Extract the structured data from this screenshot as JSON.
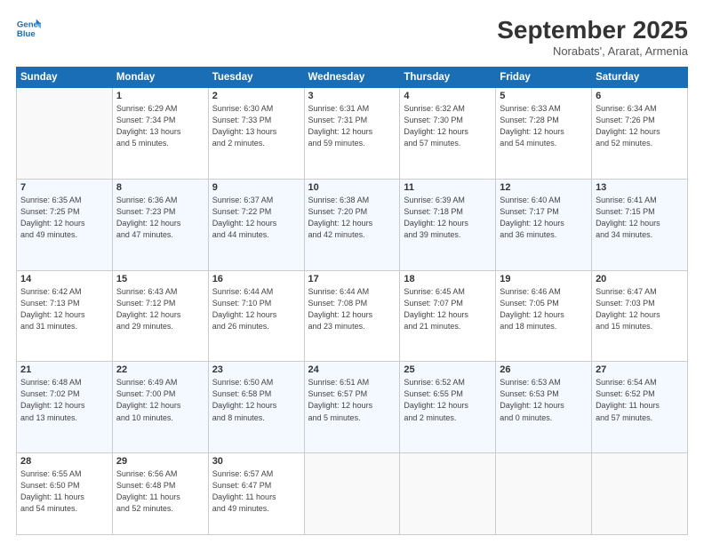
{
  "header": {
    "logo_line1": "General",
    "logo_line2": "Blue",
    "month": "September 2025",
    "location": "Norabats', Ararat, Armenia"
  },
  "days_of_week": [
    "Sunday",
    "Monday",
    "Tuesday",
    "Wednesday",
    "Thursday",
    "Friday",
    "Saturday"
  ],
  "weeks": [
    [
      {
        "day": "",
        "info": ""
      },
      {
        "day": "1",
        "info": "Sunrise: 6:29 AM\nSunset: 7:34 PM\nDaylight: 13 hours\nand 5 minutes."
      },
      {
        "day": "2",
        "info": "Sunrise: 6:30 AM\nSunset: 7:33 PM\nDaylight: 13 hours\nand 2 minutes."
      },
      {
        "day": "3",
        "info": "Sunrise: 6:31 AM\nSunset: 7:31 PM\nDaylight: 12 hours\nand 59 minutes."
      },
      {
        "day": "4",
        "info": "Sunrise: 6:32 AM\nSunset: 7:30 PM\nDaylight: 12 hours\nand 57 minutes."
      },
      {
        "day": "5",
        "info": "Sunrise: 6:33 AM\nSunset: 7:28 PM\nDaylight: 12 hours\nand 54 minutes."
      },
      {
        "day": "6",
        "info": "Sunrise: 6:34 AM\nSunset: 7:26 PM\nDaylight: 12 hours\nand 52 minutes."
      }
    ],
    [
      {
        "day": "7",
        "info": "Sunrise: 6:35 AM\nSunset: 7:25 PM\nDaylight: 12 hours\nand 49 minutes."
      },
      {
        "day": "8",
        "info": "Sunrise: 6:36 AM\nSunset: 7:23 PM\nDaylight: 12 hours\nand 47 minutes."
      },
      {
        "day": "9",
        "info": "Sunrise: 6:37 AM\nSunset: 7:22 PM\nDaylight: 12 hours\nand 44 minutes."
      },
      {
        "day": "10",
        "info": "Sunrise: 6:38 AM\nSunset: 7:20 PM\nDaylight: 12 hours\nand 42 minutes."
      },
      {
        "day": "11",
        "info": "Sunrise: 6:39 AM\nSunset: 7:18 PM\nDaylight: 12 hours\nand 39 minutes."
      },
      {
        "day": "12",
        "info": "Sunrise: 6:40 AM\nSunset: 7:17 PM\nDaylight: 12 hours\nand 36 minutes."
      },
      {
        "day": "13",
        "info": "Sunrise: 6:41 AM\nSunset: 7:15 PM\nDaylight: 12 hours\nand 34 minutes."
      }
    ],
    [
      {
        "day": "14",
        "info": "Sunrise: 6:42 AM\nSunset: 7:13 PM\nDaylight: 12 hours\nand 31 minutes."
      },
      {
        "day": "15",
        "info": "Sunrise: 6:43 AM\nSunset: 7:12 PM\nDaylight: 12 hours\nand 29 minutes."
      },
      {
        "day": "16",
        "info": "Sunrise: 6:44 AM\nSunset: 7:10 PM\nDaylight: 12 hours\nand 26 minutes."
      },
      {
        "day": "17",
        "info": "Sunrise: 6:44 AM\nSunset: 7:08 PM\nDaylight: 12 hours\nand 23 minutes."
      },
      {
        "day": "18",
        "info": "Sunrise: 6:45 AM\nSunset: 7:07 PM\nDaylight: 12 hours\nand 21 minutes."
      },
      {
        "day": "19",
        "info": "Sunrise: 6:46 AM\nSunset: 7:05 PM\nDaylight: 12 hours\nand 18 minutes."
      },
      {
        "day": "20",
        "info": "Sunrise: 6:47 AM\nSunset: 7:03 PM\nDaylight: 12 hours\nand 15 minutes."
      }
    ],
    [
      {
        "day": "21",
        "info": "Sunrise: 6:48 AM\nSunset: 7:02 PM\nDaylight: 12 hours\nand 13 minutes."
      },
      {
        "day": "22",
        "info": "Sunrise: 6:49 AM\nSunset: 7:00 PM\nDaylight: 12 hours\nand 10 minutes."
      },
      {
        "day": "23",
        "info": "Sunrise: 6:50 AM\nSunset: 6:58 PM\nDaylight: 12 hours\nand 8 minutes."
      },
      {
        "day": "24",
        "info": "Sunrise: 6:51 AM\nSunset: 6:57 PM\nDaylight: 12 hours\nand 5 minutes."
      },
      {
        "day": "25",
        "info": "Sunrise: 6:52 AM\nSunset: 6:55 PM\nDaylight: 12 hours\nand 2 minutes."
      },
      {
        "day": "26",
        "info": "Sunrise: 6:53 AM\nSunset: 6:53 PM\nDaylight: 12 hours\nand 0 minutes."
      },
      {
        "day": "27",
        "info": "Sunrise: 6:54 AM\nSunset: 6:52 PM\nDaylight: 11 hours\nand 57 minutes."
      }
    ],
    [
      {
        "day": "28",
        "info": "Sunrise: 6:55 AM\nSunset: 6:50 PM\nDaylight: 11 hours\nand 54 minutes."
      },
      {
        "day": "29",
        "info": "Sunrise: 6:56 AM\nSunset: 6:48 PM\nDaylight: 11 hours\nand 52 minutes."
      },
      {
        "day": "30",
        "info": "Sunrise: 6:57 AM\nSunset: 6:47 PM\nDaylight: 11 hours\nand 49 minutes."
      },
      {
        "day": "",
        "info": ""
      },
      {
        "day": "",
        "info": ""
      },
      {
        "day": "",
        "info": ""
      },
      {
        "day": "",
        "info": ""
      }
    ]
  ]
}
